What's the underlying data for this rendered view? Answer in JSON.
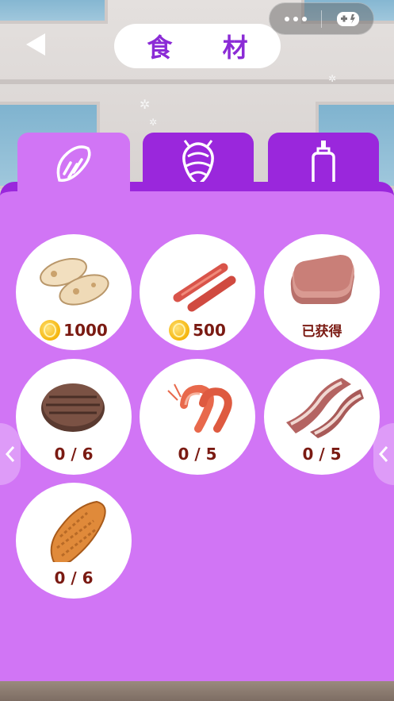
{
  "header": {
    "title": "食 材"
  },
  "tabs": [
    {
      "icon": "bread-icon",
      "active": true
    },
    {
      "icon": "shrimp-icon",
      "active": false
    },
    {
      "icon": "sauce-bottle-icon",
      "active": false
    }
  ],
  "items": [
    {
      "name": "chicken-roll",
      "status": "1000",
      "price": 1000,
      "owned": false
    },
    {
      "name": "sausage",
      "status": "500",
      "price": 500,
      "owned": false
    },
    {
      "name": "ham-slices",
      "status": "已获得",
      "owned": true
    },
    {
      "name": "beef-patty",
      "status": "0 / 6",
      "progress": 0,
      "total": 6
    },
    {
      "name": "shrimp",
      "status": "0 / 5",
      "progress": 0,
      "total": 5
    },
    {
      "name": "bacon",
      "status": "0 / 5",
      "progress": 0,
      "total": 5
    },
    {
      "name": "chicken-cutlet",
      "status": "0 / 6",
      "progress": 0,
      "total": 6
    }
  ],
  "colors": {
    "panel": "#d175f5",
    "tab_inactive": "#9a27dc",
    "title_text": "#8b2bd6",
    "label_text": "#7a1a12",
    "coin": "#f5b50b"
  }
}
